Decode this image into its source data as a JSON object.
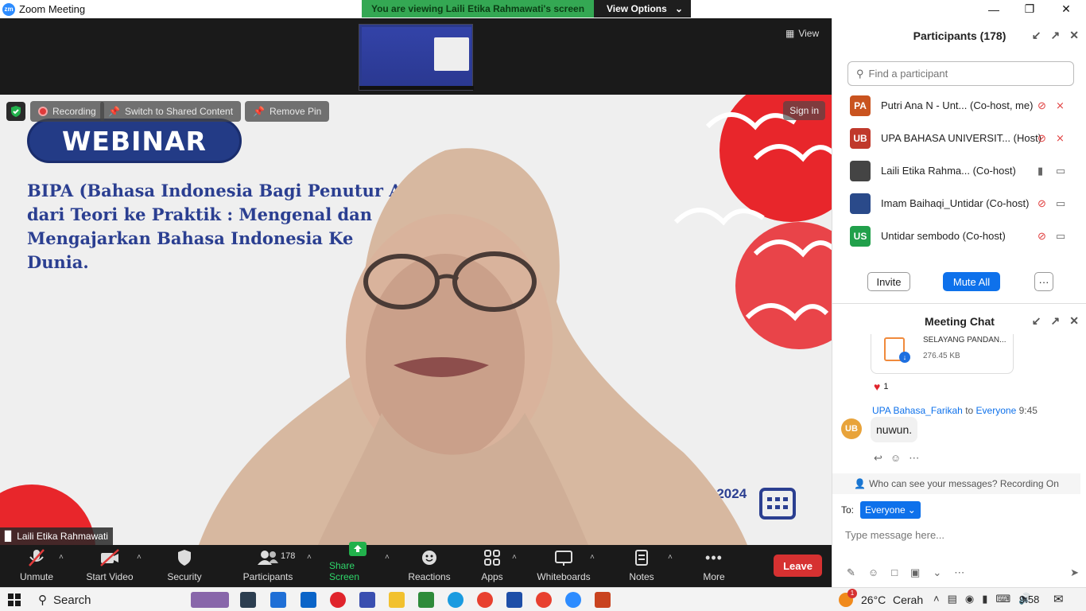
{
  "window": {
    "title": "Zoom Meeting",
    "logo_text": "zm"
  },
  "banner": {
    "viewing_text": "You are viewing Laili Etika Rahmawati's screen",
    "view_options": "View Options"
  },
  "video": {
    "view_label": "View",
    "recording_label": "Recording",
    "switch_label": "Switch to Shared Content",
    "remove_pin_label": "Remove Pin",
    "sign_in": "Sign in",
    "speaker_name": "Laili Etika Rahmawati",
    "slide": {
      "badge": "WEBINAR",
      "lines": [
        "BIPA (Bahasa Indonesia Bagi Penutur A",
        "dari Teori ke Praktik : Mengenal dan",
        "Mengajarkan Bahasa Indonesia Ke",
        "Dunia."
      ],
      "date_fragment": "r 2024"
    }
  },
  "toolbar": {
    "unmute": "Unmute",
    "start_video": "Start Video",
    "security": "Security",
    "participants": "Participants",
    "participants_count": "178",
    "share_screen": "Share Screen",
    "reactions": "Reactions",
    "apps": "Apps",
    "whiteboards": "Whiteboards",
    "notes": "Notes",
    "more": "More",
    "leave": "Leave"
  },
  "participants_panel": {
    "title": "Participants (178)",
    "search_placeholder": "Find a participant",
    "items": [
      {
        "initials": "PA",
        "name": "Putri Ana N - Unt... (Co-host, me)",
        "color": "#c9531f",
        "mic": "muted",
        "cam": "off"
      },
      {
        "initials": "UB",
        "name": "UPA BAHASA UNIVERSIT... (Host)",
        "color": "#c0392b",
        "mic": "muted",
        "cam": "off"
      },
      {
        "initials": "",
        "name": "Laili Etika Rahma... (Co-host)",
        "color": "#444444",
        "mic": "on",
        "cam": "on"
      },
      {
        "initials": "",
        "name": "Imam Baihaqi_Untidar (Co-host)",
        "color": "#2a4a8a",
        "mic": "muted",
        "cam": "on"
      },
      {
        "initials": "US",
        "name": "Untidar sembodo (Co-host)",
        "color": "#21a04b",
        "mic": "muted",
        "cam": "on"
      }
    ],
    "invite": "Invite",
    "mute_all": "Mute All",
    "more": "···"
  },
  "chat_panel": {
    "title": "Meeting Chat",
    "file_name": "SELAYANG PANDAN...",
    "file_size": "276.45 KB",
    "reaction_count": "1",
    "sender": "UPA Bahasa_Farikah",
    "to_word": "to",
    "recipient": "Everyone",
    "time": "9:45",
    "sender_initials": "UB",
    "message": "nuwun.",
    "privacy_note": "Who can see your messages? Recording On",
    "to_label": "To:",
    "to_value": "Everyone",
    "input_placeholder": "Type message here..."
  },
  "taskbar": {
    "search": "Search",
    "temperature": "26°C",
    "weather": "Cerah",
    "clock": "9:58",
    "weather_badge": "1"
  }
}
